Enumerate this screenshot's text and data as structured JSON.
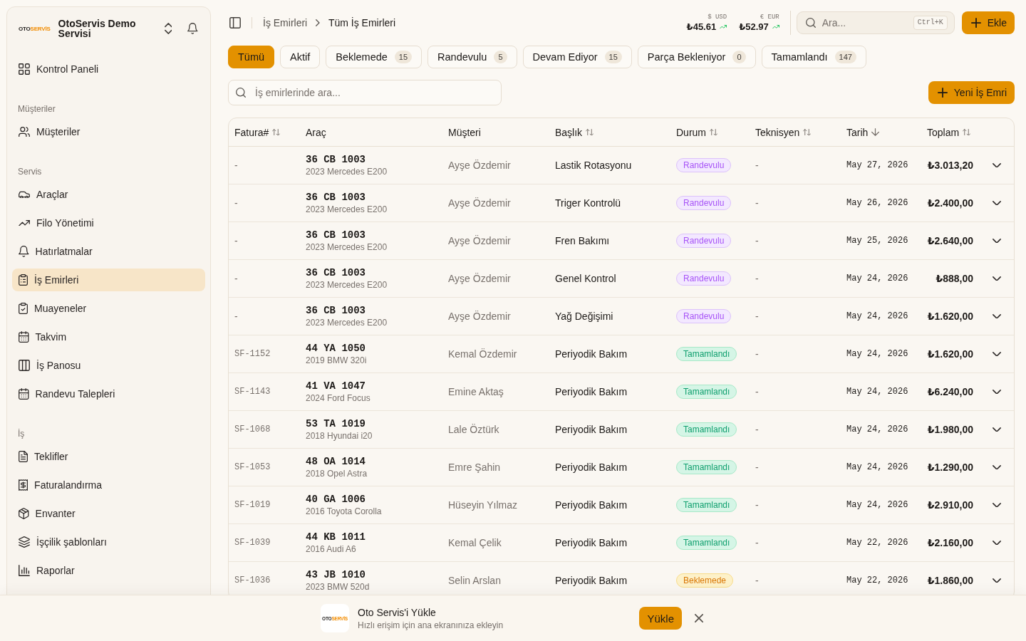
{
  "sidebar": {
    "logo": {
      "prefix": "OTO",
      "suffix": "SERVİS"
    },
    "service_name": "OtoServis Demo Servisi",
    "sections": [
      {
        "items": [
          {
            "label": "Kontrol Paneli",
            "selected": false
          }
        ]
      },
      {
        "label": "Müşteriler",
        "items": [
          {
            "label": "Müşteriler",
            "selected": false
          }
        ]
      },
      {
        "label": "Servis",
        "items": [
          {
            "label": "Araçlar",
            "selected": false
          },
          {
            "label": "Filo Yönetimi",
            "selected": false
          },
          {
            "label": "Hatırlatmalar",
            "selected": false
          },
          {
            "label": "İş Emirleri",
            "selected": true
          },
          {
            "label": "Muayeneler",
            "selected": false
          },
          {
            "label": "Takvim",
            "selected": false
          },
          {
            "label": "İş Panosu",
            "selected": false
          },
          {
            "label": "Randevu Talepleri",
            "selected": false
          }
        ]
      },
      {
        "label": "İş",
        "items": [
          {
            "label": "Teklifler",
            "selected": false
          },
          {
            "label": "Faturalandırma",
            "selected": false
          },
          {
            "label": "Envanter",
            "selected": false
          },
          {
            "label": "İşçilik şablonları",
            "selected": false
          },
          {
            "label": "Raporlar",
            "selected": false
          }
        ]
      }
    ]
  },
  "topbar": {
    "breadcrumb": [
      "İş Emirleri",
      "Tüm İş Emirleri"
    ],
    "rates": [
      {
        "label": "$ USD",
        "value": "₺45.61"
      },
      {
        "label": "€ EUR",
        "value": "₺52.97"
      }
    ],
    "search": {
      "placeholder": "Ara...",
      "shortcut": "Ctrl+K"
    },
    "add_button": "Ekle"
  },
  "filters": [
    {
      "label": "Tümü",
      "selected": true
    },
    {
      "label": "Aktif",
      "selected": false
    },
    {
      "label": "Beklemede",
      "count": "15",
      "selected": false
    },
    {
      "label": "Randevulu",
      "count": "5",
      "selected": false
    },
    {
      "label": "Devam Ediyor",
      "count": "15",
      "selected": false
    },
    {
      "label": "Parça Bekleniyor",
      "count": "0",
      "selected": false
    },
    {
      "label": "Tamamlandı",
      "count": "147",
      "selected": false
    }
  ],
  "toolbar": {
    "search": {
      "placeholder": "İş emirlerinde ara..."
    },
    "new_button": "Yeni İş Emri"
  },
  "table": {
    "columns": [
      {
        "label": "Fatura#",
        "sortable": true,
        "sorted": false
      },
      {
        "label": "Araç",
        "sortable": false,
        "sorted": false
      },
      {
        "label": "Müşteri",
        "sortable": false,
        "sorted": false
      },
      {
        "label": "Başlık",
        "sortable": true,
        "sorted": false
      },
      {
        "label": "Durum",
        "sortable": true,
        "sorted": false
      },
      {
        "label": "Teknisyen",
        "sortable": true,
        "sorted": false
      },
      {
        "label": "Tarih",
        "sortable": true,
        "sorted": true
      },
      {
        "label": "Toplam",
        "sortable": true,
        "sorted": false
      }
    ],
    "rows": [
      {
        "invoice": "-",
        "plate": "36 CB 1003",
        "vehicle": "2023 Mercedes E200",
        "customer": "Ayşe Özdemir",
        "title": "Lastik Rotasyonu",
        "status": {
          "label": "Randevulu",
          "kind": "scheduled"
        },
        "technician": "-",
        "date": "May 27, 2026",
        "total": "₺3.013,20"
      },
      {
        "invoice": "-",
        "plate": "36 CB 1003",
        "vehicle": "2023 Mercedes E200",
        "customer": "Ayşe Özdemir",
        "title": "Triger Kontrolü",
        "status": {
          "label": "Randevulu",
          "kind": "scheduled"
        },
        "technician": "-",
        "date": "May 26, 2026",
        "total": "₺2.400,00"
      },
      {
        "invoice": "-",
        "plate": "36 CB 1003",
        "vehicle": "2023 Mercedes E200",
        "customer": "Ayşe Özdemir",
        "title": "Fren Bakımı",
        "status": {
          "label": "Randevulu",
          "kind": "scheduled"
        },
        "technician": "-",
        "date": "May 25, 2026",
        "total": "₺2.640,00"
      },
      {
        "invoice": "-",
        "plate": "36 CB 1003",
        "vehicle": "2023 Mercedes E200",
        "customer": "Ayşe Özdemir",
        "title": "Genel Kontrol",
        "status": {
          "label": "Randevulu",
          "kind": "scheduled"
        },
        "technician": "-",
        "date": "May 24, 2026",
        "total": "₺888,00"
      },
      {
        "invoice": "-",
        "plate": "36 CB 1003",
        "vehicle": "2023 Mercedes E200",
        "customer": "Ayşe Özdemir",
        "title": "Yağ Değişimi",
        "status": {
          "label": "Randevulu",
          "kind": "scheduled"
        },
        "technician": "-",
        "date": "May 24, 2026",
        "total": "₺1.620,00"
      },
      {
        "invoice": "SF-1152",
        "plate": "44 YA 1050",
        "vehicle": "2019 BMW 320i",
        "customer": "Kemal Özdemir",
        "title": "Periyodik Bakım",
        "status": {
          "label": "Tamamlandı",
          "kind": "done"
        },
        "technician": "-",
        "date": "May 24, 2026",
        "total": "₺1.620,00"
      },
      {
        "invoice": "SF-1143",
        "plate": "41 VA 1047",
        "vehicle": "2024 Ford Focus",
        "customer": "Emine Aktaş",
        "title": "Periyodik Bakım",
        "status": {
          "label": "Tamamlandı",
          "kind": "done"
        },
        "technician": "-",
        "date": "May 24, 2026",
        "total": "₺6.240,00"
      },
      {
        "invoice": "SF-1068",
        "plate": "53 TA 1019",
        "vehicle": "2018 Hyundai i20",
        "customer": "Lale Öztürk",
        "title": "Periyodik Bakım",
        "status": {
          "label": "Tamamlandı",
          "kind": "done"
        },
        "technician": "-",
        "date": "May 24, 2026",
        "total": "₺1.980,00"
      },
      {
        "invoice": "SF-1053",
        "plate": "48 OA 1014",
        "vehicle": "2018 Opel Astra",
        "customer": "Emre Şahin",
        "title": "Periyodik Bakım",
        "status": {
          "label": "Tamamlandı",
          "kind": "done"
        },
        "technician": "-",
        "date": "May 24, 2026",
        "total": "₺1.290,00"
      },
      {
        "invoice": "SF-1019",
        "plate": "40 GA 1006",
        "vehicle": "2016 Toyota Corolla",
        "customer": "Hüseyin Yılmaz",
        "title": "Periyodik Bakım",
        "status": {
          "label": "Tamamlandı",
          "kind": "done"
        },
        "technician": "-",
        "date": "May 24, 2026",
        "total": "₺2.910,00"
      },
      {
        "invoice": "SF-1039",
        "plate": "44 KB 1011",
        "vehicle": "2016 Audi A6",
        "customer": "Kemal Çelik",
        "title": "Periyodik Bakım",
        "status": {
          "label": "Tamamlandı",
          "kind": "done"
        },
        "technician": "-",
        "date": "May 22, 2026",
        "total": "₺2.160,00"
      },
      {
        "invoice": "SF-1036",
        "plate": "43 JB 1010",
        "vehicle": "2023 BMW 520d",
        "customer": "Selin Arslan",
        "title": "Periyodik Bakım",
        "status": {
          "label": "Beklemede",
          "kind": "pending"
        },
        "technician": "-",
        "date": "May 22, 2026",
        "total": "₺1.860,00"
      }
    ]
  },
  "install_banner": {
    "logo": {
      "prefix": "OTO",
      "suffix": "SERVİS"
    },
    "title": "Oto Servis'i Yükle",
    "subtitle": "Hızlı erişim için ana ekranınıza ekleyin",
    "button": "Yükle"
  }
}
